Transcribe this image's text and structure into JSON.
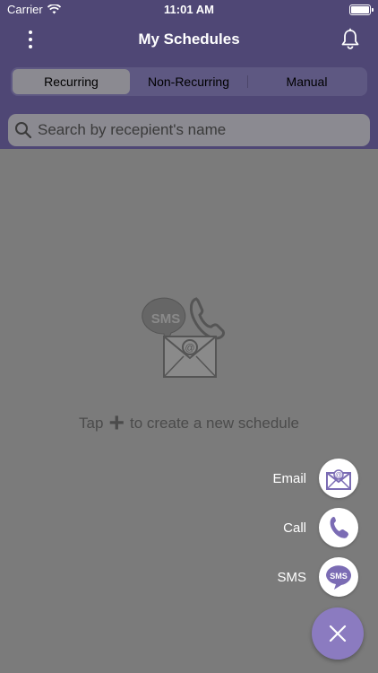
{
  "status": {
    "carrier": "Carrier",
    "time": "11:01 AM"
  },
  "nav": {
    "title": "My Schedules"
  },
  "segments": [
    "Recurring",
    "Non-Recurring",
    "Manual"
  ],
  "search": {
    "placeholder": "Search by recepient's name",
    "value": ""
  },
  "empty": {
    "prefix": "Tap",
    "suffix": "to create a new schedule",
    "sms_badge": "SMS"
  },
  "fab": {
    "actions": [
      {
        "label": "Email",
        "icon": "email-icon"
      },
      {
        "label": "Call",
        "icon": "phone-icon"
      },
      {
        "label": "SMS",
        "icon": "sms-icon",
        "badge": "SMS"
      }
    ]
  },
  "colors": {
    "accent": "#8b7bc0",
    "header_dim": "#4f4775",
    "overlay_bg": "#7b7b7b"
  }
}
